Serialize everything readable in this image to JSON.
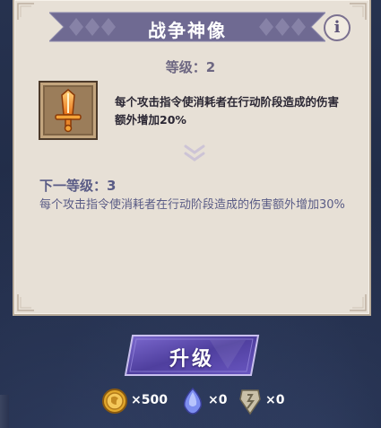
{
  "header": {
    "title": "战争神像",
    "info_icon_glyph": "i"
  },
  "level": {
    "label": "等级：2"
  },
  "item": {
    "icon": "sword-icon",
    "description": "每个攻击指令使消耗者在行动阶段造成的伤害额外增加20%"
  },
  "next_level": {
    "label": "下一等级：3",
    "description": "每个攻击指令使消耗者在行动阶段造成的伤害额外增加30%"
  },
  "action": {
    "upgrade_label": "升级"
  },
  "costs": [
    {
      "icon": "gold-coin-icon",
      "amount": "×500"
    },
    {
      "icon": "blue-gem-icon",
      "amount": "×0"
    },
    {
      "icon": "rune-stone-icon",
      "amount": "×0"
    }
  ],
  "colors": {
    "panel_bg": "#e7e0d6",
    "banner": "#6f6a92",
    "text_blue": "#5a5c86",
    "button_purple": "#5b4aa6",
    "background": "#1f2a44"
  }
}
